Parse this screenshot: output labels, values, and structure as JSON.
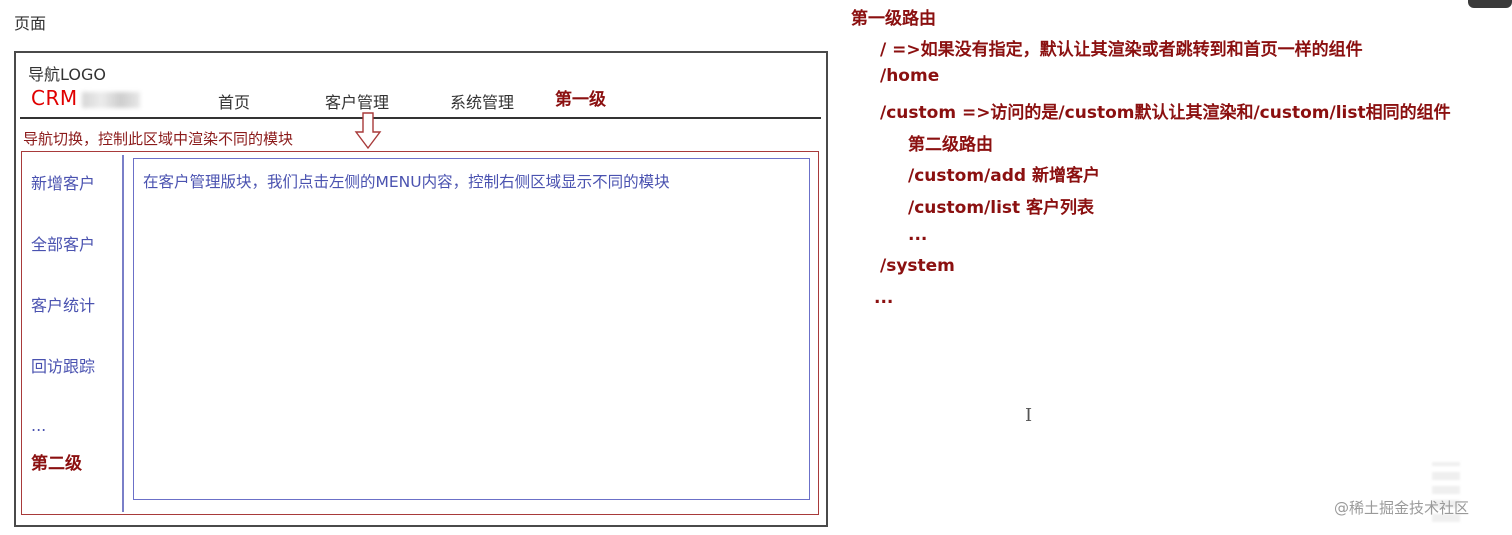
{
  "page_label": "页面",
  "nav": {
    "logo_label": "导航LOGO",
    "crm_label": "CRM",
    "items": [
      "首页",
      "客户管理",
      "系统管理"
    ],
    "level_label": "第一级",
    "note": "导航切换，控制此区域中渲染不同的模块"
  },
  "menu": {
    "items": [
      "新增客户",
      "全部客户",
      "客户统计",
      "回访跟踪",
      "..."
    ],
    "level_label": "第二级"
  },
  "content": {
    "text": "在客户管理版块，我们点击左侧的MENU内容，控制右侧区域显示不同的模块"
  },
  "routes": {
    "title": "第一级路由",
    "root": "/  =>如果没有指定，默认让其渲染或者跳转到和首页一样的组件",
    "home": "/home",
    "custom": "/custom   =>访问的是/custom默认让其渲染和/custom/list相同的组件",
    "level2_title": "第二级路由",
    "add": "/custom/add  新增客户",
    "list": "/custom/list   客户列表",
    "dots1": "...",
    "system": "/system",
    "dots2": "..."
  },
  "cursor_glyph": "I",
  "watermark": "@稀土掘金技术社区",
  "colors": {
    "route_text": "#8b1010",
    "menu_text": "#4a52b0",
    "crm_red": "#e00000"
  }
}
